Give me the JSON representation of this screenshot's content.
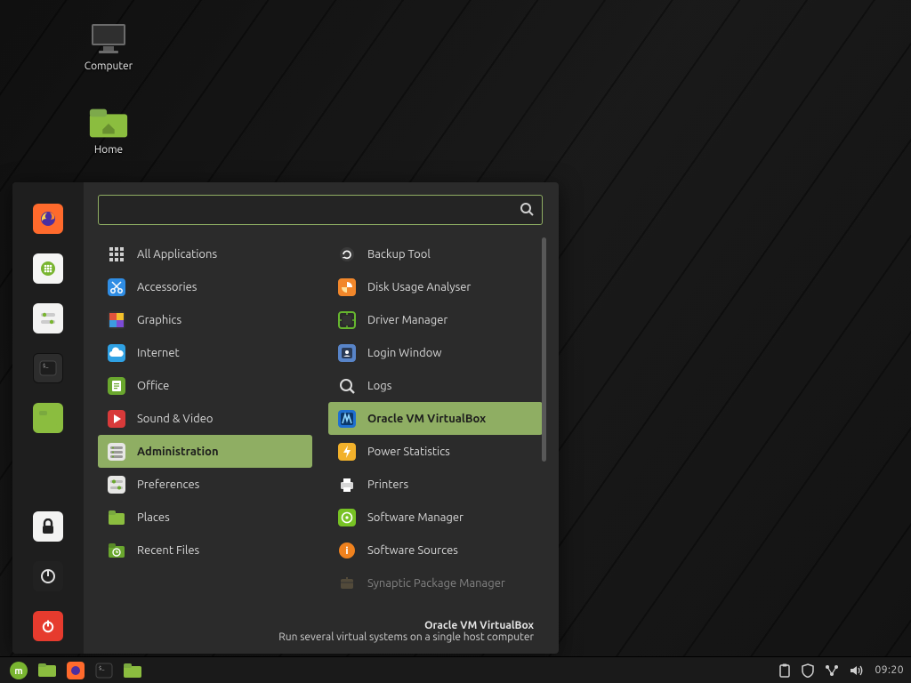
{
  "desktop": {
    "icons": [
      {
        "name": "computer",
        "label": "Computer"
      },
      {
        "name": "home",
        "label": "Home"
      }
    ]
  },
  "menu": {
    "search_placeholder": "",
    "favorites": [
      {
        "name": "firefox"
      },
      {
        "name": "apps-grid"
      },
      {
        "name": "settings"
      },
      {
        "name": "terminal"
      },
      {
        "name": "files"
      },
      {
        "name": "lock"
      },
      {
        "name": "logout"
      },
      {
        "name": "power"
      }
    ],
    "categories": [
      {
        "label": "All Applications",
        "icon": "grid",
        "color": "#9a9a9a"
      },
      {
        "label": "Accessories",
        "icon": "scissors",
        "color": "#2f8de4"
      },
      {
        "label": "Graphics",
        "icon": "palette",
        "color": "#e1533c"
      },
      {
        "label": "Internet",
        "icon": "cloud",
        "color": "#2fa1e4"
      },
      {
        "label": "Office",
        "icon": "doc",
        "color": "#6aa72e"
      },
      {
        "label": "Sound & Video",
        "icon": "play",
        "color": "#d83a3a"
      },
      {
        "label": "Administration",
        "icon": "admin",
        "color": "#7da24b",
        "selected": true
      },
      {
        "label": "Preferences",
        "icon": "prefs",
        "color": "#7a7a7a"
      },
      {
        "label": "Places",
        "icon": "folder",
        "color": "#8bbd3f"
      },
      {
        "label": "Recent Files",
        "icon": "recent",
        "color": "#6aa72e"
      }
    ],
    "apps": [
      {
        "label": "Backup Tool",
        "icon": "backup",
        "color": "#3a3a3a"
      },
      {
        "label": "Disk Usage Analyser",
        "icon": "disk",
        "color": "#f2872b"
      },
      {
        "label": "Driver Manager",
        "icon": "driver",
        "color": "#66b62f"
      },
      {
        "label": "Login Window",
        "icon": "login",
        "color": "#5884c8"
      },
      {
        "label": "Logs",
        "icon": "logs",
        "color": "#3a3a3a"
      },
      {
        "label": "Oracle VM VirtualBox",
        "icon": "vbox",
        "color": "#1f6fd0",
        "selected": true
      },
      {
        "label": "Power Statistics",
        "icon": "power",
        "color": "#f2b12b"
      },
      {
        "label": "Printers",
        "icon": "printer",
        "color": "#dedede"
      },
      {
        "label": "Software Manager",
        "icon": "swmgr",
        "color": "#77c224"
      },
      {
        "label": "Software Sources",
        "icon": "swsrc",
        "color": "#f0821e"
      },
      {
        "label": "Synaptic Package Manager",
        "icon": "synaptic",
        "color": "#7a6a4a",
        "dim": true
      }
    ],
    "description": {
      "title": "Oracle VM VirtualBox",
      "text": "Run several virtual systems on a single host computer"
    }
  },
  "panel": {
    "launchers": [
      {
        "name": "menu",
        "tip": "Menu"
      },
      {
        "name": "show-desktop",
        "tip": "Show desktop"
      },
      {
        "name": "firefox"
      },
      {
        "name": "terminal"
      },
      {
        "name": "files"
      }
    ],
    "tray": [
      {
        "name": "clipboard-icon"
      },
      {
        "name": "shield-icon"
      },
      {
        "name": "network-icon"
      },
      {
        "name": "volume-icon"
      }
    ],
    "clock": "09:20"
  },
  "colors": {
    "accent": "#8fae63"
  }
}
